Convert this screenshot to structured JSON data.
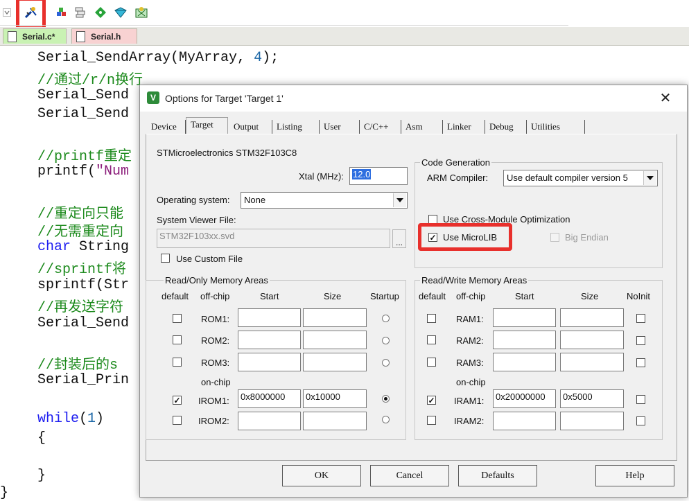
{
  "editor": {
    "tabs": [
      {
        "label": "Serial.c*",
        "state": "active"
      },
      {
        "label": "Serial.h",
        "state": "inactive"
      }
    ],
    "toolbar_icons": [
      "chevron-down-icon",
      "target-options-icon",
      "manage-components-icon",
      "file-extensions-icon",
      "pack-installer-icon",
      "select-pack-icon",
      "run-time-environment-icon"
    ],
    "highlight_color": "#e8302c",
    "code": {
      "line1_a": "Serial_SendArray(MyArray, ",
      "line1_num": "4",
      "line1_b": ");",
      "line2": "//通过/r/n换行",
      "line3": "Serial_Send",
      "line4": "Serial_Send",
      "line5": "//printf重定",
      "line6_a": "printf(",
      "line6_str": "\"Num",
      "line7": "//重定向只能",
      "line8": "//无需重定向",
      "line9_kw": "char",
      "line9_b": " String",
      "line10": "//sprintf将",
      "line11": "sprintf(Str",
      "line12": "//再发送字符",
      "line13": "Serial_Send",
      "line14": "//封装后的s",
      "line15": "Serial_Prin",
      "line16_kw": "while",
      "line16_a": "(",
      "line16_num": "1",
      "line16_b": ")",
      "open_brace": "{",
      "close_brace": "}",
      "outer_brace": "}"
    }
  },
  "dialog": {
    "title": "Options for Target 'Target 1'",
    "close_glyph": "✕",
    "app_icon_letter": "V",
    "tabs": [
      "Device",
      "Target",
      "Output",
      "Listing",
      "User",
      "C/C++",
      "Asm",
      "Linker",
      "Debug",
      "Utilities"
    ],
    "selected_tab": "Target",
    "device_name": "STMicroelectronics STM32F103C8",
    "xtal_label": "Xtal (MHz):",
    "xtal_value": "12.0",
    "os_label": "Operating system:",
    "os_value": "None",
    "svd_label": "System Viewer File:",
    "svd_value": "STM32F103xx.svd",
    "browse_label": "...",
    "use_custom_file": {
      "label": "Use Custom File",
      "checked": false
    },
    "code_generation": {
      "title": "Code Generation",
      "compiler_label": "ARM Compiler:",
      "compiler_value": "Use default compiler version 5",
      "cross_module": {
        "label": "Use Cross-Module Optimization",
        "checked": false
      },
      "microlib": {
        "label": "Use MicroLIB",
        "checked": true
      },
      "big_endian": {
        "label": "Big Endian",
        "checked": false,
        "disabled": true
      }
    },
    "ro_memory": {
      "title": "Read/Only Memory Areas",
      "headers": [
        "default",
        "off-chip",
        "Start",
        "Size",
        "Startup"
      ],
      "onchip_label": "on-chip",
      "rows": [
        {
          "name": "ROM1:",
          "default": false,
          "start": "",
          "size": "",
          "startup": false
        },
        {
          "name": "ROM2:",
          "default": false,
          "start": "",
          "size": "",
          "startup": false
        },
        {
          "name": "ROM3:",
          "default": false,
          "start": "",
          "size": "",
          "startup": false
        },
        {
          "name": "IROM1:",
          "default": true,
          "start": "0x8000000",
          "size": "0x10000",
          "startup": true
        },
        {
          "name": "IROM2:",
          "default": false,
          "start": "",
          "size": "",
          "startup": false
        }
      ]
    },
    "rw_memory": {
      "title": "Read/Write Memory Areas",
      "headers": [
        "default",
        "off-chip",
        "Start",
        "Size",
        "NoInit"
      ],
      "onchip_label": "on-chip",
      "rows": [
        {
          "name": "RAM1:",
          "default": false,
          "start": "",
          "size": "",
          "noinit": false
        },
        {
          "name": "RAM2:",
          "default": false,
          "start": "",
          "size": "",
          "noinit": false
        },
        {
          "name": "RAM3:",
          "default": false,
          "start": "",
          "size": "",
          "noinit": false
        },
        {
          "name": "IRAM1:",
          "default": true,
          "start": "0x20000000",
          "size": "0x5000",
          "noinit": false
        },
        {
          "name": "IRAM2:",
          "default": false,
          "start": "",
          "size": "",
          "noinit": false
        }
      ]
    },
    "buttons": {
      "ok": "OK",
      "cancel": "Cancel",
      "defaults": "Defaults",
      "help": "Help"
    }
  }
}
